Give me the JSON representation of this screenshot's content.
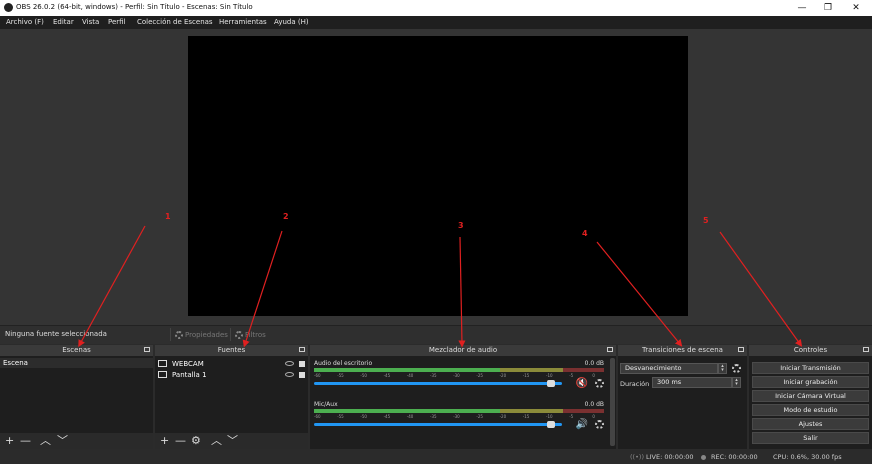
{
  "window": {
    "title": "OBS 26.0.2 (64-bit, windows) - Perfil: Sin Título - Escenas: Sin Título",
    "minimize": "—",
    "maximize": "❐",
    "close": "✕"
  },
  "menu": [
    "Archivo (F)",
    "Editar",
    "Vista",
    "Perfil",
    "Colección de Escenas",
    "Herramientas",
    "Ayuda (H)"
  ],
  "source_bar": {
    "no_source": "Ninguna fuente seleccionada",
    "properties": "Propiedades",
    "filters": "Filtros"
  },
  "docks": {
    "scenes": {
      "title": "Escenas",
      "items": [
        "Escena"
      ]
    },
    "sources": {
      "title": "Fuentes",
      "items": [
        "WEBCAM",
        "Pantalla 1"
      ]
    },
    "mixer": {
      "title": "Mezclador de audio",
      "channels": [
        {
          "name": "Audio del escritorio",
          "db": "0.0 dB",
          "volume": 0.95,
          "muted": true
        },
        {
          "name": "Mic/Aux",
          "db": "0.0 dB",
          "volume": 0.95,
          "muted": false
        }
      ],
      "ticks": [
        "-60",
        "-55",
        "-50",
        "-45",
        "-40",
        "-35",
        "-30",
        "-25",
        "-20",
        "-15",
        "-10",
        "-5",
        "0"
      ]
    },
    "transitions": {
      "title": "Transiciones de escena",
      "transition": "Desvanecimiento",
      "duration_label": "Duración",
      "duration_value": "300 ms"
    },
    "controls": {
      "title": "Controles",
      "buttons": [
        "Iniciar Transmisión",
        "Iniciar grabación",
        "Iniciar Cámara Virtual",
        "Modo de estudio",
        "Ajustes",
        "Salir"
      ]
    }
  },
  "status": {
    "live": "LIVE: 00:00:00",
    "rec": "REC: 00:00:00",
    "cpu": "CPU: 0.6%, 30.00 fps"
  },
  "annotations": [
    "1",
    "2",
    "3",
    "4",
    "5"
  ],
  "colors": {
    "annotation": "#e02020",
    "accent": "#2196f3"
  }
}
